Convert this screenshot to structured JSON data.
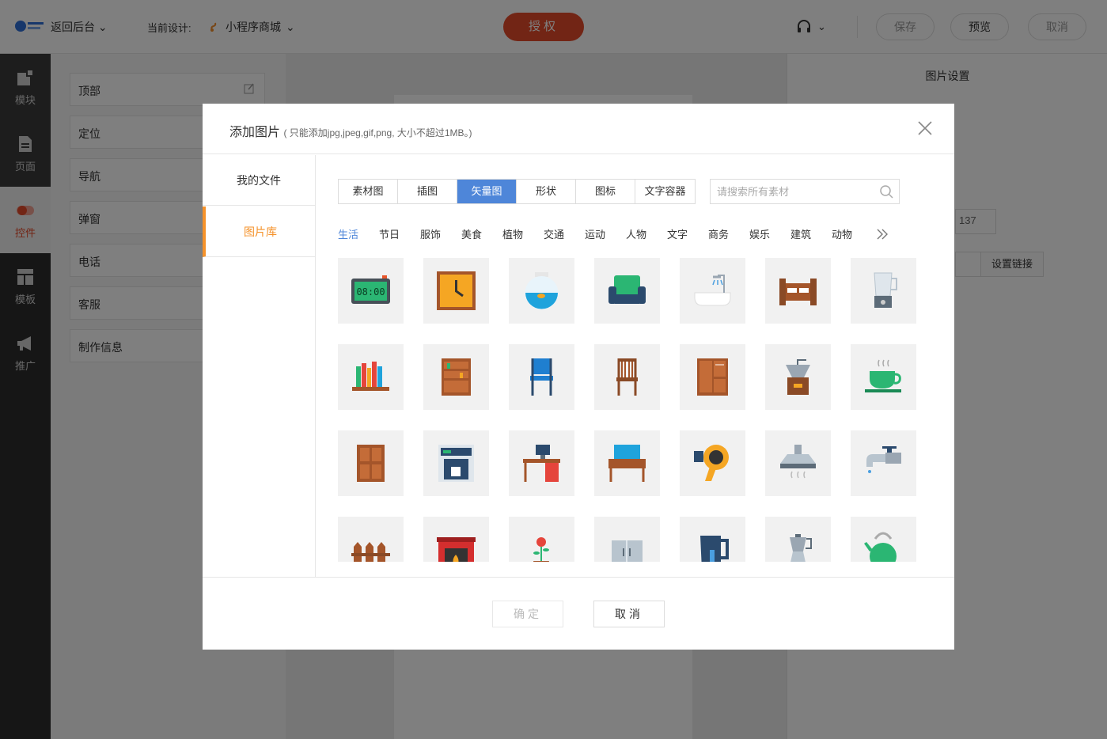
{
  "topbar": {
    "back_label": "返回后台",
    "current_design_label": "当前设计:",
    "current_design_value": "小程序商城",
    "auth_label": "授权",
    "save_label": "保存",
    "preview_label": "预览",
    "cancel_label": "取消"
  },
  "rail": {
    "items": [
      {
        "label": "模块",
        "icon": "blocks-icon"
      },
      {
        "label": "页面",
        "icon": "page-icon"
      },
      {
        "label": "控件",
        "icon": "toggle-icon"
      },
      {
        "label": "模板",
        "icon": "template-icon"
      },
      {
        "label": "推广",
        "icon": "megaphone-icon"
      }
    ]
  },
  "left_panel": {
    "items": [
      "顶部",
      "定位",
      "导航",
      "弹窗",
      "电话",
      "客服",
      "制作信息"
    ]
  },
  "right_panel": {
    "title": "图片设置",
    "number_value": "137",
    "link_button": "设置链接"
  },
  "modal": {
    "title": "添加图片",
    "hint": "( 只能添加jpg,jpeg,gif,png, 大小不超过1MB。)",
    "side_tabs": [
      "我的文件",
      "图片库"
    ],
    "type_tabs": [
      "素材图",
      "插图",
      "矢量图",
      "形状",
      "图标",
      "文字容器"
    ],
    "active_type": "矢量图",
    "search_placeholder": "请搜索所有素材",
    "categories": [
      "生活",
      "节日",
      "服饰",
      "美食",
      "植物",
      "交通",
      "运动",
      "人物",
      "文字",
      "商务",
      "娱乐",
      "建筑",
      "动物"
    ],
    "active_category": "生活",
    "confirm_label": "确定",
    "cancel_label": "取消"
  },
  "gallery": {
    "items": [
      "digital-clock-icon",
      "wall-clock-icon",
      "fishbowl-icon",
      "armchair-icon",
      "bathtub-icon",
      "bed-icon",
      "blender-icon",
      "bookshelf-icon",
      "cabinet-icon",
      "blue-chair-icon",
      "wooden-chair-icon",
      "wardrobe-icon",
      "coffee-grinder-icon",
      "teacup-icon",
      "door-icon",
      "coffee-machine-icon",
      "desk-computer-icon",
      "dressing-table-icon",
      "hair-dryer-icon",
      "range-hood-icon",
      "faucet-icon",
      "fence-icon",
      "fireplace-icon",
      "potted-flower-icon",
      "fridge-icon",
      "kettle-icon",
      "moka-pot-icon",
      "watering-can-icon"
    ]
  },
  "colors": {
    "accent_orange": "#f5922a",
    "accent_blue": "#4e86d9",
    "brand_red": "#e54b2a"
  }
}
